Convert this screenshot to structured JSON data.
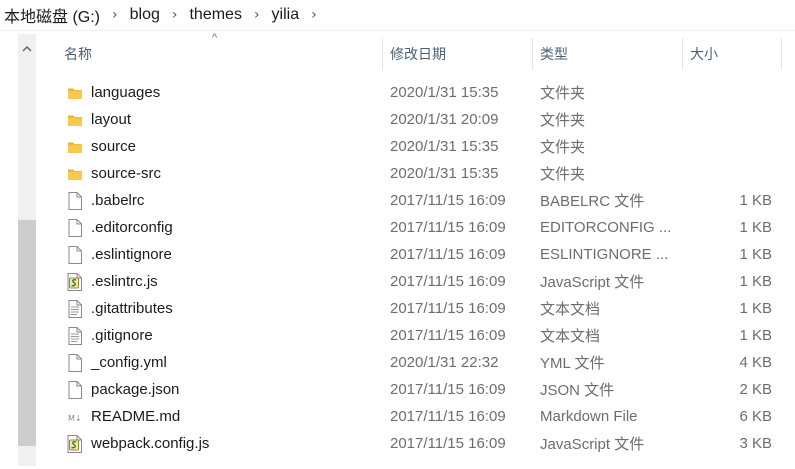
{
  "breadcrumb": [
    "本地磁盘 (G:)",
    "blog",
    "themes",
    "yilia"
  ],
  "columns": {
    "name": "名称",
    "date": "修改日期",
    "type": "类型",
    "size": "大小"
  },
  "files": [
    {
      "name": "languages",
      "date": "2020/1/31 15:35",
      "type": "文件夹",
      "size": "",
      "icon": "folder-icon"
    },
    {
      "name": "layout",
      "date": "2020/1/31 20:09",
      "type": "文件夹",
      "size": "",
      "icon": "folder-icon"
    },
    {
      "name": "source",
      "date": "2020/1/31 15:35",
      "type": "文件夹",
      "size": "",
      "icon": "folder-icon"
    },
    {
      "name": "source-src",
      "date": "2020/1/31 15:35",
      "type": "文件夹",
      "size": "",
      "icon": "folder-icon"
    },
    {
      "name": ".babelrc",
      "date": "2017/11/15 16:09",
      "type": "BABELRC 文件",
      "size": "1 KB",
      "icon": "blank-file-icon"
    },
    {
      "name": ".editorconfig",
      "date": "2017/11/15 16:09",
      "type": "EDITORCONFIG ...",
      "size": "1 KB",
      "icon": "blank-file-icon"
    },
    {
      "name": ".eslintignore",
      "date": "2017/11/15 16:09",
      "type": "ESLINTIGNORE ...",
      "size": "1 KB",
      "icon": "blank-file-icon"
    },
    {
      "name": ".eslintrc.js",
      "date": "2017/11/15 16:09",
      "type": "JavaScript 文件",
      "size": "1 KB",
      "icon": "script-file-icon"
    },
    {
      "name": ".gitattributes",
      "date": "2017/11/15 16:09",
      "type": "文本文档",
      "size": "1 KB",
      "icon": "text-file-icon"
    },
    {
      "name": ".gitignore",
      "date": "2017/11/15 16:09",
      "type": "文本文档",
      "size": "1 KB",
      "icon": "text-file-icon"
    },
    {
      "name": "_config.yml",
      "date": "2020/1/31 22:32",
      "type": "YML 文件",
      "size": "4 KB",
      "icon": "blank-file-icon"
    },
    {
      "name": "package.json",
      "date": "2017/11/15 16:09",
      "type": "JSON 文件",
      "size": "2 KB",
      "icon": "blank-file-icon"
    },
    {
      "name": "README.md",
      "date": "2017/11/15 16:09",
      "type": "Markdown File",
      "size": "6 KB",
      "icon": "markdown-file-icon"
    },
    {
      "name": "webpack.config.js",
      "date": "2017/11/15 16:09",
      "type": "JavaScript 文件",
      "size": "3 KB",
      "icon": "script-file-icon"
    }
  ],
  "colors": {
    "folder": "#f8c94a",
    "header_text": "#4c607a",
    "meta_text": "#6d6d6d"
  }
}
